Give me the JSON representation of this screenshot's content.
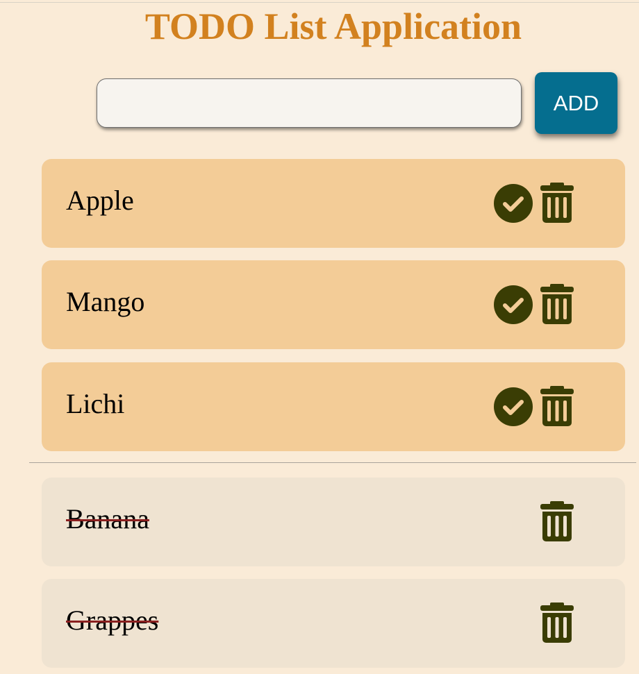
{
  "app": {
    "title": "TODO List Application"
  },
  "input": {
    "value": "",
    "placeholder": ""
  },
  "add_button": {
    "label": "ADD"
  },
  "pending_items": [
    {
      "label": "Apple"
    },
    {
      "label": "Mango"
    },
    {
      "label": "Lichi"
    }
  ],
  "completed_items": [
    {
      "label": "Banana"
    },
    {
      "label": "Grappes"
    }
  ],
  "icons": {
    "complete": "check-circle-icon",
    "delete": "trash-icon"
  },
  "colors": {
    "background": "#faebd7",
    "title": "#d2811f",
    "add_button": "#056e8f",
    "pending_item": "#f3cc97",
    "completed_item": "#efe3d1",
    "icon": "#3a3d04",
    "strikethrough": "#8b2020"
  }
}
